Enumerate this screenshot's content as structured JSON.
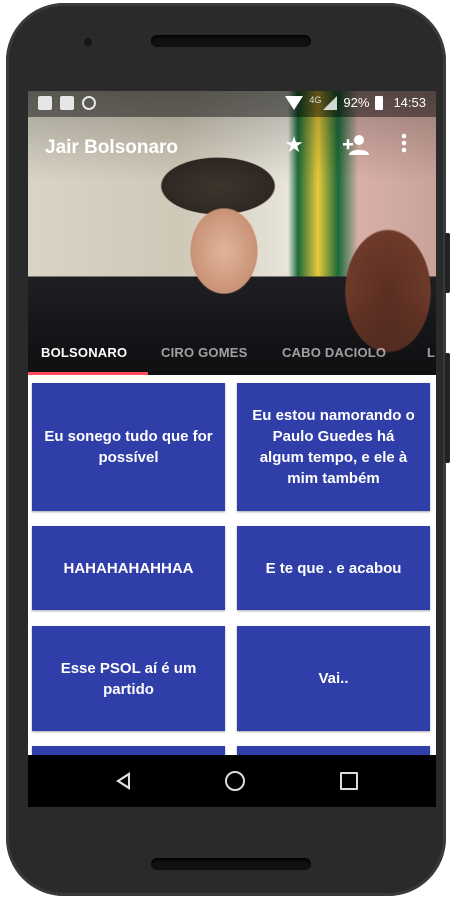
{
  "status_bar": {
    "network": "4G",
    "battery": "92%",
    "time": "14:53"
  },
  "toolbar": {
    "title": "Jair Bolsonaro"
  },
  "tabs": [
    "BOLSONARO",
    "CIRO GOMES",
    "CABO DACIOLO",
    "L"
  ],
  "active_tab": 0,
  "cards": [
    "Eu sonego tudo que for possível",
    "Eu estou namorando o Paulo Guedes há algum tempo, e ele à mim também",
    "HAHAHAHAHHAA",
    "E te que . e acabou",
    "Esse PSOL aí é um partido",
    "Vai..",
    "",
    ""
  ],
  "colors": {
    "card": "#2f3ea8",
    "tab_indicator": "#ff4d5e",
    "navbar": "#000000"
  },
  "icons": [
    "star-icon",
    "add-person-icon",
    "more-vert-icon"
  ]
}
